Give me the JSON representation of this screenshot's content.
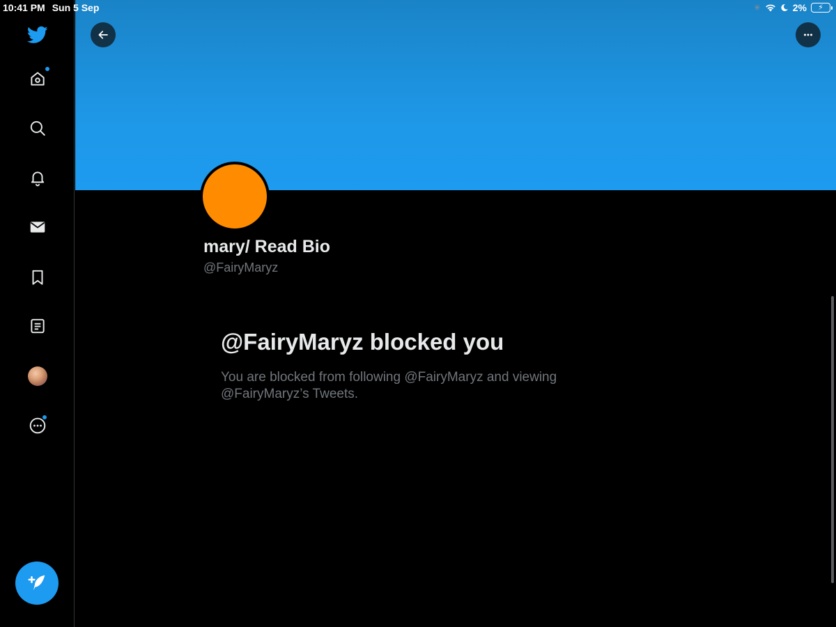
{
  "status_bar": {
    "time": "10:41 PM",
    "date": "Sun 5 Sep",
    "battery": "2%"
  },
  "sidebar": {
    "items": [
      {
        "icon": "twitter-logo-icon"
      },
      {
        "icon": "home-icon",
        "notification_dot": true
      },
      {
        "icon": "search-icon"
      },
      {
        "icon": "bell-icon"
      },
      {
        "icon": "mail-icon"
      },
      {
        "icon": "bookmark-icon"
      },
      {
        "icon": "lists-icon"
      },
      {
        "icon": "profile-avatar"
      },
      {
        "icon": "more-icon",
        "notification_dot": true
      }
    ],
    "compose_icon": "compose-tweet-icon"
  },
  "profile": {
    "name": "mary/ Read Bio",
    "handle": "@FairyMaryz",
    "avatar_color": "#FF8C00",
    "banner_color": "#1D9BF0"
  },
  "blocked": {
    "title": "@FairyMaryz blocked you",
    "description": "You are blocked from following @FairyMaryz and viewing @FairyMaryz’s Tweets."
  },
  "colors": {
    "accent": "#1D9BF0",
    "background": "#000000",
    "secondary_text": "#71767B"
  }
}
